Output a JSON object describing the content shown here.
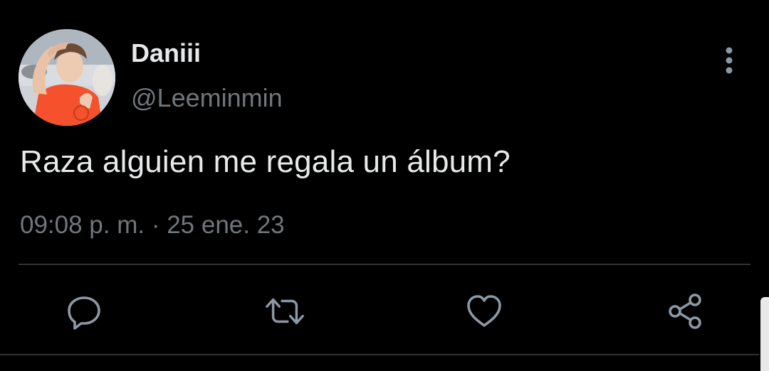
{
  "tweet": {
    "author": {
      "display_name": "Daniii",
      "handle": "@Leeminmin"
    },
    "text": "Raza alguien me regala un álbum?",
    "timestamp": "09:08 p. m. · 25 ene. 23"
  },
  "icons": {
    "more": "more-vertical-icon",
    "reply": "reply-icon",
    "retweet": "retweet-icon",
    "like": "heart-icon",
    "share": "share-icon"
  },
  "colors": {
    "background": "#000000",
    "primary_text": "#e7e9ea",
    "secondary_text": "#71767b",
    "divider": "#2f3336"
  }
}
